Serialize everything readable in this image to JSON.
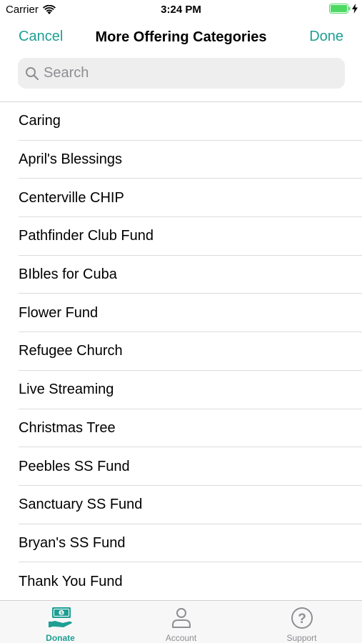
{
  "status_bar": {
    "carrier": "Carrier",
    "time": "3:24 PM"
  },
  "nav": {
    "cancel_label": "Cancel",
    "title": "More Offering Categories",
    "done_label": "Done"
  },
  "search": {
    "placeholder": "Search",
    "value": ""
  },
  "categories": [
    "Caring",
    "April's Blessings",
    "Centerville CHIP",
    "Pathfinder Club Fund",
    "BIbles for Cuba",
    "Flower Fund",
    "Refugee Church",
    "Live Streaming",
    "Christmas Tree",
    "Peebles SS Fund",
    "Sanctuary SS Fund",
    "Bryan's SS Fund",
    "Thank You Fund"
  ],
  "tab_bar": {
    "tabs": [
      {
        "label": "Donate",
        "icon": "donate-icon",
        "active": true
      },
      {
        "label": "Account",
        "icon": "account-icon",
        "active": false
      },
      {
        "label": "Support",
        "icon": "support-icon",
        "active": false
      }
    ]
  },
  "colors": {
    "accent": "#1e9f93",
    "inactive": "#8e8e93",
    "battery": "#4cd964"
  }
}
